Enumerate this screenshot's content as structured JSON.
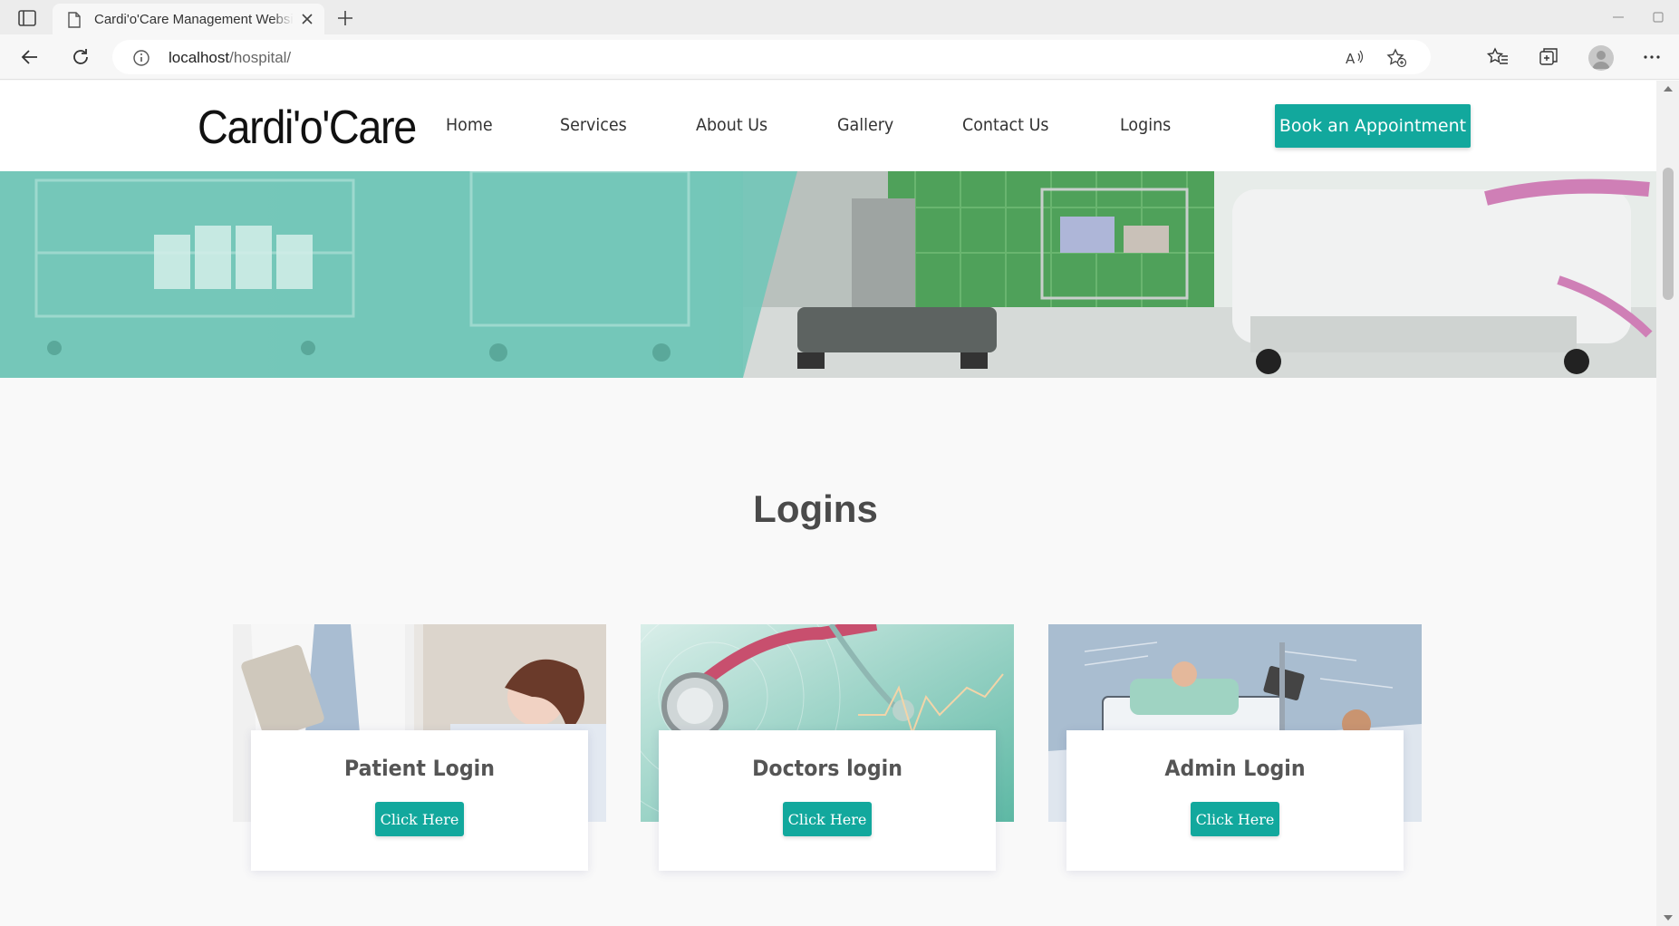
{
  "browser": {
    "tab_title": "Cardi'o'Care Management Website",
    "url_host": "localhost",
    "url_path": "/hospital/"
  },
  "site": {
    "brand": "Cardi'o'Care",
    "nav": [
      "Home",
      "Services",
      "About Us",
      "Gallery",
      "Contact Us",
      "Logins"
    ],
    "cta_label": "Book an Appointment",
    "accent_color": "#12a89d"
  },
  "hero": {
    "slides": 2,
    "active_slide": 1
  },
  "logins": {
    "title": "Logins",
    "cards": [
      {
        "title": "Patient Login",
        "button": "Click Here"
      },
      {
        "title": "Doctors login",
        "button": "Click Here"
      },
      {
        "title": "Admin Login",
        "button": "Click Here"
      }
    ]
  }
}
